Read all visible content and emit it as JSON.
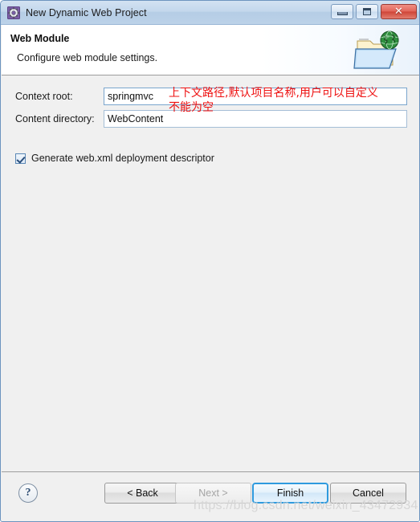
{
  "window": {
    "title": "New Dynamic Web Project",
    "icon": "web-project-gear-icon",
    "controls": {
      "minimize": "Minimize",
      "maximize": "Maximize",
      "close": "Close",
      "close_glyph": "✕"
    }
  },
  "header": {
    "title": "Web Module",
    "subtitle": "Configure web module settings.",
    "icon": "folder-globe-icon"
  },
  "form": {
    "context_root": {
      "label": "Context root:",
      "value": "springmvc"
    },
    "content_directory": {
      "label": "Content directory:",
      "value": "WebContent"
    },
    "generate_webxml": {
      "label": "Generate web.xml deployment descriptor",
      "checked": true
    }
  },
  "annotations": {
    "line1": "上下文路径,默认项目名称,用户可以自定义",
    "line2": "不能为空",
    "color": "#ee1111"
  },
  "footer": {
    "help": "?",
    "buttons": {
      "back": "< Back",
      "next": "Next >",
      "finish": "Finish",
      "cancel": "Cancel"
    }
  },
  "watermark": "https://blog.csdn.net/weixin_43472934",
  "colors": {
    "titlebar": "#bcd2e8",
    "body": "#f0f0f0",
    "accent": "#2e9ade",
    "annotation": "#ee1111"
  }
}
